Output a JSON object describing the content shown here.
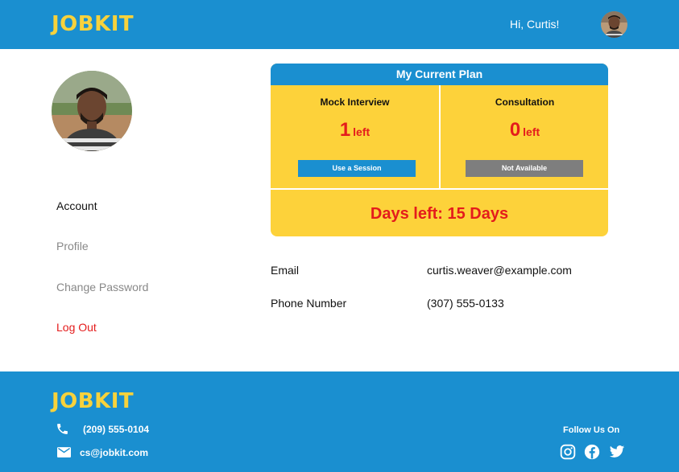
{
  "header": {
    "logo": "JOBKIT",
    "greeting": "Hi, Curtis!"
  },
  "sidebar": {
    "items": [
      {
        "label": "Account"
      },
      {
        "label": "Profile"
      },
      {
        "label": "Change Password"
      },
      {
        "label": "Log Out"
      }
    ]
  },
  "plan": {
    "title": "My Current Plan",
    "mock": {
      "title": "Mock Interview",
      "count": "1",
      "unit": "left",
      "button": "Use a Session"
    },
    "consult": {
      "title": "Consultation",
      "count": "0",
      "unit": "left",
      "button": "Not Available"
    },
    "days_left": "Days left: 15 Days"
  },
  "info": {
    "email_label": "Email",
    "email_value": "curtis.weaver@example.com",
    "phone_label": "Phone Number",
    "phone_value": "(307) 555-0133"
  },
  "footer": {
    "logo": "JOBKIT",
    "phone": "(209) 555-0104",
    "email": "cs@jobkit.com",
    "follow": "Follow Us On"
  },
  "colors": {
    "primary": "#1a8fd0",
    "accent": "#f7d23c",
    "danger": "#e41c1c",
    "plan_bg": "#fdd23a"
  },
  "icons": [
    "phone-icon",
    "mail-icon",
    "instagram-icon",
    "facebook-icon",
    "twitter-icon"
  ]
}
